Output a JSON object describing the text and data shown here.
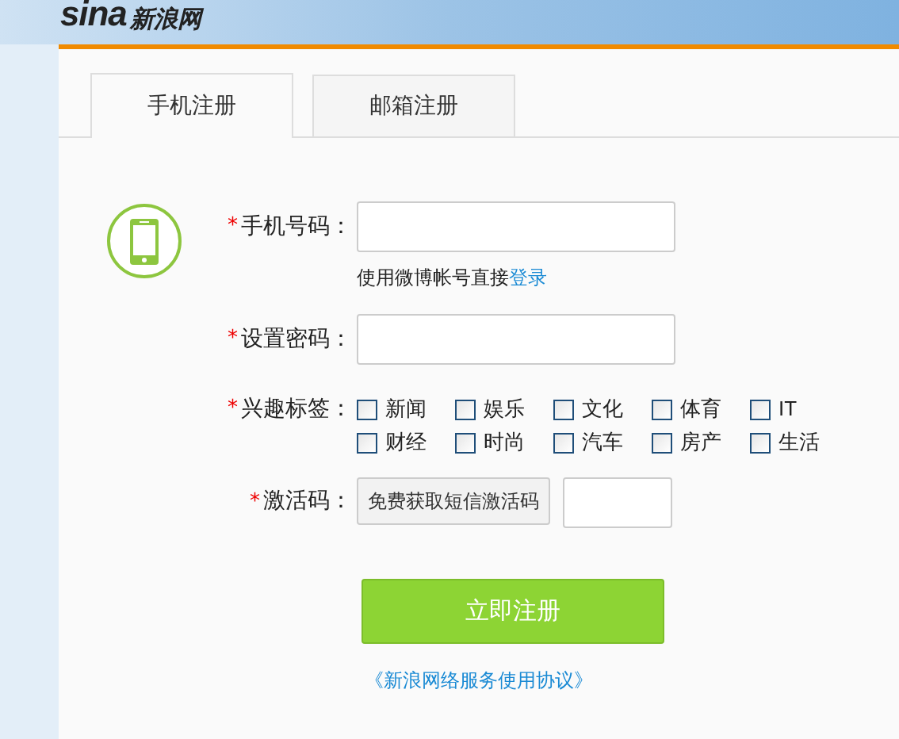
{
  "logo": {
    "latin": "sina",
    "chinese": "新浪网"
  },
  "tabs": [
    {
      "label": "手机注册",
      "selected": true
    },
    {
      "label": "邮箱注册",
      "selected": false
    }
  ],
  "form": {
    "phone": {
      "label": "手机号码：",
      "marker": "*"
    },
    "hint": {
      "text": "使用微博帐号直接",
      "link": "登录"
    },
    "password": {
      "label": "设置密码：",
      "marker": "*"
    },
    "interests": {
      "label": "兴趣标签：",
      "marker": "*",
      "options": [
        {
          "label": "新闻",
          "checked": false
        },
        {
          "label": "娱乐",
          "checked": false
        },
        {
          "label": "文化",
          "checked": false
        },
        {
          "label": "体育",
          "checked": false
        },
        {
          "label": "IT",
          "checked": false
        },
        {
          "label": "财经",
          "checked": false
        },
        {
          "label": "时尚",
          "checked": false
        },
        {
          "label": "汽车",
          "checked": false
        },
        {
          "label": "房产",
          "checked": false
        },
        {
          "label": "生活",
          "checked": false
        }
      ]
    },
    "activation": {
      "label": "激活码：",
      "marker": "*",
      "button": "免费获取短信激活码"
    },
    "submit": "立即注册",
    "agreement": "《新浪网络服务使用协议》"
  }
}
